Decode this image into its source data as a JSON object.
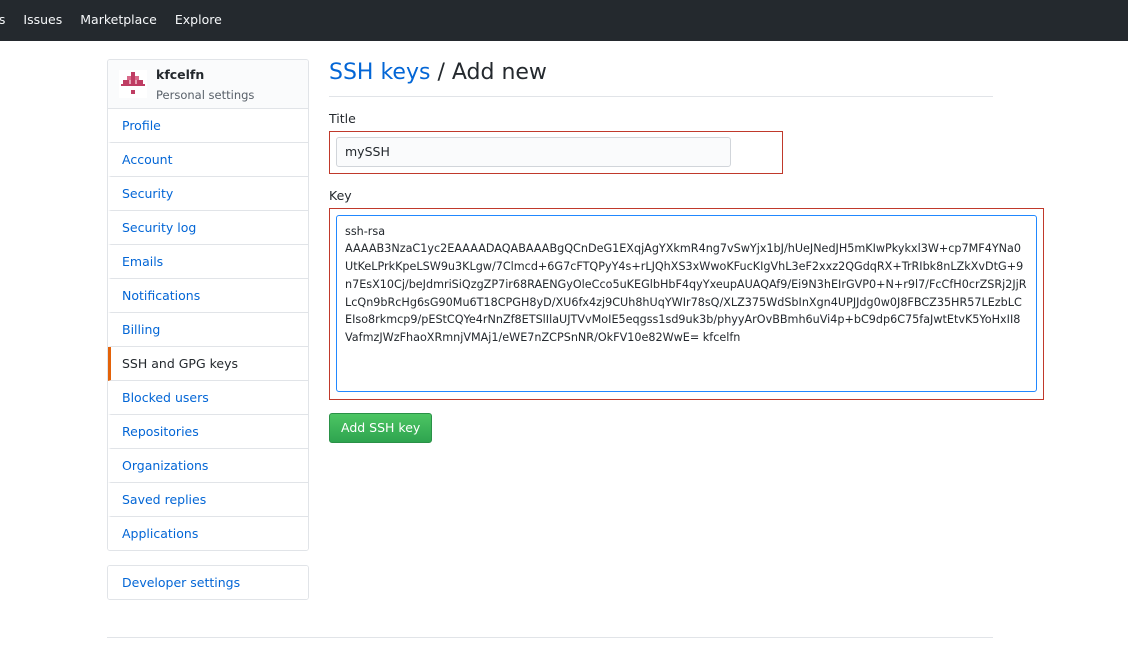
{
  "navbar": {
    "items": [
      {
        "label": "ts"
      },
      {
        "label": "Issues"
      },
      {
        "label": "Marketplace"
      },
      {
        "label": "Explore"
      }
    ],
    "background_color": "#24292e"
  },
  "sidebar": {
    "account": {
      "name": "kfcelfn",
      "subtitle": "Personal settings",
      "avatar_icon": "identicon-avatar",
      "avatar_color": "#bf3d63"
    },
    "items": [
      {
        "label": "Profile",
        "selected": false
      },
      {
        "label": "Account",
        "selected": false
      },
      {
        "label": "Security",
        "selected": false
      },
      {
        "label": "Security log",
        "selected": false
      },
      {
        "label": "Emails",
        "selected": false
      },
      {
        "label": "Notifications",
        "selected": false
      },
      {
        "label": "Billing",
        "selected": false
      },
      {
        "label": "SSH and GPG keys",
        "selected": true
      },
      {
        "label": "Blocked users",
        "selected": false
      },
      {
        "label": "Repositories",
        "selected": false
      },
      {
        "label": "Organizations",
        "selected": false
      },
      {
        "label": "Saved replies",
        "selected": false
      },
      {
        "label": "Applications",
        "selected": false
      }
    ],
    "secondary_items": [
      {
        "label": "Developer settings"
      }
    ],
    "selected_accent_color": "#e36209",
    "link_color": "#0366d6"
  },
  "main": {
    "title_link": "SSH keys",
    "title_separator": " / ",
    "title_current": "Add new",
    "title_link_color": "#0366d6",
    "title_label": {
      "text": "Title"
    },
    "title_field": {
      "value": "mySSH",
      "placeholder": ""
    },
    "key_label": {
      "text": "Key"
    },
    "key_field": {
      "value": "ssh-rsa\nAAAAB3NzaC1yc2EAAAADAQABAAABgQCnDeG1EXqjAgYXkmR4ng7vSwYjx1bJ/hUeJNedJH5mKIwPkykxl3W+cp7MF4YNa0UtKeLPrkKpeLSW9u3KLgw/7Clmcd+6G7cFTQPyY4s+rLJQhXS3xWwoKFucKIgVhL3eF2xxz2QGdqRX+TrRIbk8nLZkXvDtG+9n7EsX10Cj/beJdmriSiQzgZP7ir68RAENGyOleCco5uKEGlbHbF4qyYxeupAUAQAf9/Ei9N3hEIrGVP0+N+r9l7/FcCfH0crZSRj2JjRLcQn9bRcHg6sG90Mu6T18CPGH8yD/XU6fx4zj9CUh8hUqYWIr78sQ/XLZ375WdSbInXgn4UPJJdg0w0J8FBCZ35HR57LEzbLCEIso8rkmcp9/pEStCQYe4rNnZf8ETSlIlaUJTVvMoIE5eqgss1sd9uk3b/phyyArOvBBmh6uVi4p+bC9dp6C75faJwtEtvK5YoHxII8VafmzJWzFhaoXRmnjVMAj1/eWE7nZCPSnNR/OkFV10e82WwE= kfcelfn",
      "placeholder": "",
      "focus_border_color": "#2188ff"
    },
    "submit_button": {
      "label": "Add SSH key",
      "color": "#2ea44f"
    },
    "annotation_color": "#c0392b"
  }
}
